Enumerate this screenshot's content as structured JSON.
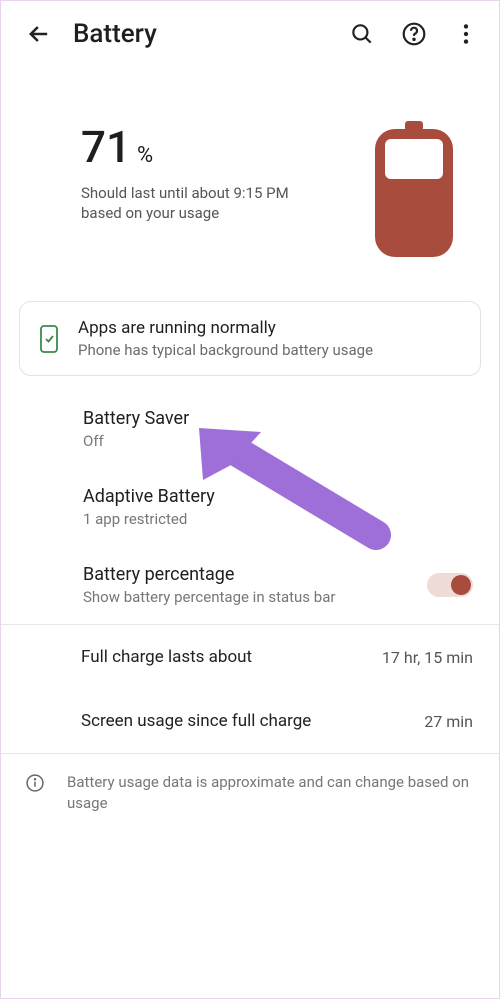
{
  "header": {
    "title": "Battery"
  },
  "overview": {
    "percent_number": "71",
    "percent_symbol": "%",
    "estimate": "Should last until about 9:15 PM based on your usage"
  },
  "card": {
    "title": "Apps are running normally",
    "subtitle": "Phone has typical background battery usage"
  },
  "rows": {
    "saver": {
      "title": "Battery Saver",
      "subtitle": "Off"
    },
    "adaptive": {
      "title": "Adaptive Battery",
      "subtitle": "1 app restricted"
    },
    "percentage": {
      "title": "Battery percentage",
      "subtitle": "Show battery percentage in status bar"
    }
  },
  "stats": {
    "full_label": "Full charge lasts about",
    "full_value": "17 hr, 15 min",
    "screen_label": "Screen usage since full charge",
    "screen_value": "27 min"
  },
  "footer": {
    "text": "Battery usage data is approximate and can change based on usage"
  },
  "colors": {
    "accent": "#a84d3e",
    "arrow": "#9e6fd8"
  }
}
